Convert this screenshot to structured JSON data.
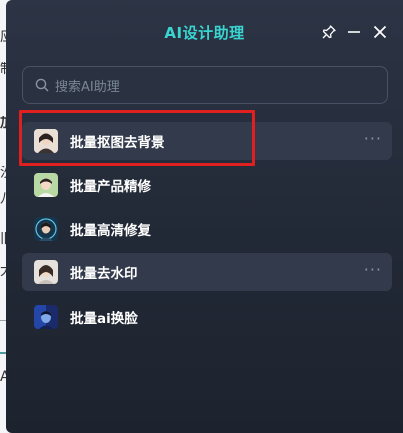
{
  "background_fragments": [
    "应",
    "制",
    "加",
    "沙",
    "八",
    "旧",
    "大",
    "A"
  ],
  "window": {
    "title": "AI设计助理",
    "pin_icon": "pin-icon",
    "minimize_icon": "minimize-icon",
    "close_icon": "close-icon"
  },
  "search": {
    "placeholder": "搜索AI助理",
    "icon": "search-icon"
  },
  "items": [
    {
      "label": "批量抠图去背景",
      "more": "···",
      "avatar_color": "#d9c7b5",
      "highlighted": true
    },
    {
      "label": "批量产品精修",
      "more": "",
      "avatar_color": "#9bc48a",
      "highlighted": false
    },
    {
      "label": "批量高清修复",
      "more": "",
      "avatar_color": "#2f6f8f",
      "highlighted": false
    },
    {
      "label": "批量去水印",
      "more": "···",
      "avatar_color": "#cfc6c0",
      "highlighted": true
    },
    {
      "label": "批量ai换脸",
      "more": "",
      "avatar_color": "#3a5fb8",
      "highlighted": false
    }
  ],
  "annotation_color": "#e0201e"
}
